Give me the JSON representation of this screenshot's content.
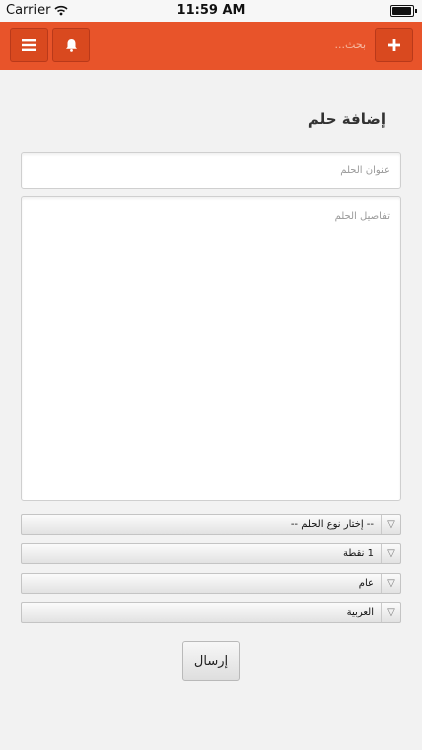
{
  "status_bar": {
    "carrier": "Carrier",
    "time": "11:59 AM",
    "battery_level": 0.95
  },
  "app_bar": {
    "color": "#e8542a",
    "menu_icon": "menu-icon",
    "notifications_icon": "bell-icon",
    "search_placeholder": "بحث...",
    "add_icon": "plus-icon"
  },
  "form": {
    "title": "إضافة حلم",
    "title_placeholder": "عنوان الحلم",
    "details_placeholder": "تفاصيل الحلم",
    "selects": [
      {
        "value": "-- إختار نوع الحلم --"
      },
      {
        "value": "1 نقطة"
      },
      {
        "value": "عام"
      },
      {
        "value": "العربية"
      }
    ],
    "submit_label": "إرسال"
  }
}
